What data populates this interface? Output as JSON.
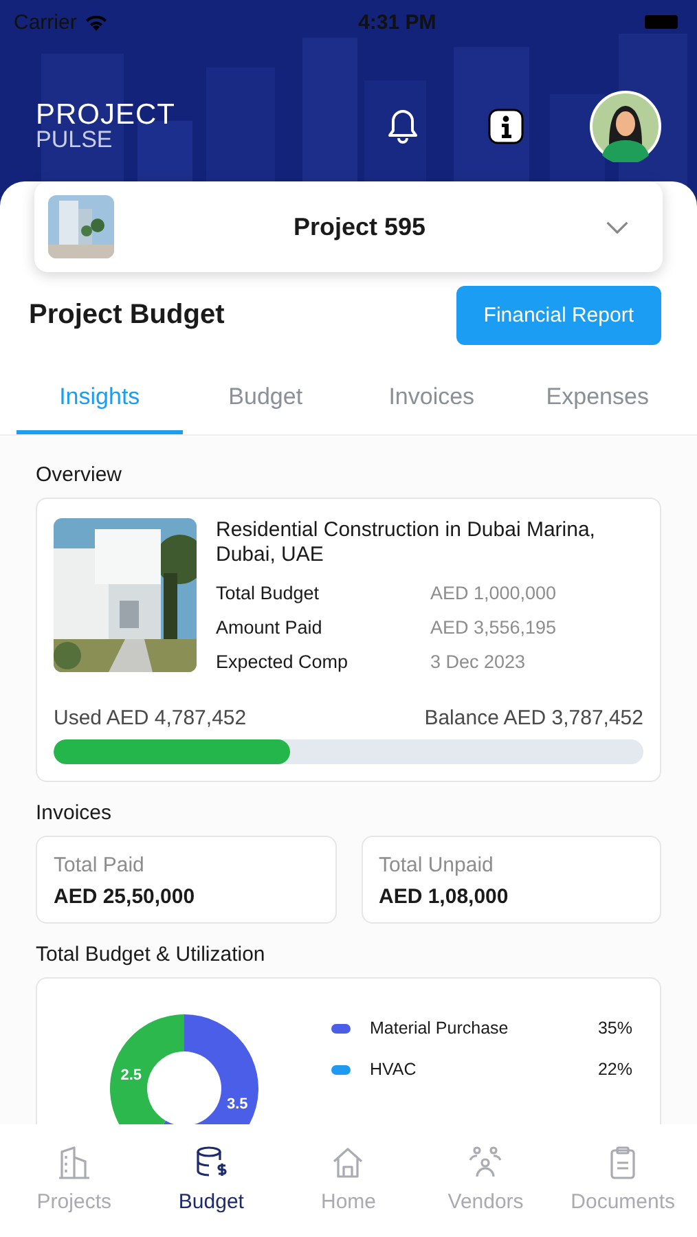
{
  "status_bar": {
    "carrier": "Carrier",
    "time": "4:31 PM"
  },
  "header": {
    "logo_top": "PROJECT",
    "logo_bottom": "PULSE"
  },
  "project_selector": {
    "name": "Project 595"
  },
  "page_title": "Project Budget",
  "report_button": "Financial Report",
  "tabs": [
    {
      "label": "Insights",
      "selected": true
    },
    {
      "label": "Budget",
      "selected": false
    },
    {
      "label": "Invoices",
      "selected": false
    },
    {
      "label": "Expenses",
      "selected": false
    }
  ],
  "overview": {
    "heading": "Overview",
    "title": "Residential Construction in Dubai Marina, Dubai, UAE",
    "details": [
      {
        "label": "Total Budget",
        "value": "AED 1,000,000"
      },
      {
        "label": "Amount Paid",
        "value": "AED 3,556,195"
      },
      {
        "label": "Expected Comp",
        "value": "3 Dec 2023"
      }
    ],
    "used": "Used AED 4,787,452",
    "balance": "Balance AED 3,787,452",
    "level": 0.4
  },
  "invoices": {
    "heading": "Invoices",
    "cards": [
      {
        "label": "Total Paid",
        "value": "AED 25,50,000"
      },
      {
        "label": "Total Unpaid",
        "value": "AED 1,08,000"
      }
    ]
  },
  "utilization": {
    "heading": "Total Budget & Utilization",
    "chart_data": {
      "type": "donut",
      "values": [
        2.5,
        3.5
      ],
      "data_labels": true
    },
    "legend": [
      {
        "name": "Material Purchase",
        "percent": "35%",
        "color": "#4a5ee8"
      },
      {
        "name": "HVAC",
        "percent": "22%",
        "color": "#1e9bf0"
      }
    ]
  },
  "nav": [
    {
      "label": "Projects",
      "selected": false
    },
    {
      "label": "Budget",
      "selected": true
    },
    {
      "label": "Home",
      "selected": false
    },
    {
      "label": "Vendors",
      "selected": false
    },
    {
      "label": "Documents",
      "selected": false
    }
  ]
}
